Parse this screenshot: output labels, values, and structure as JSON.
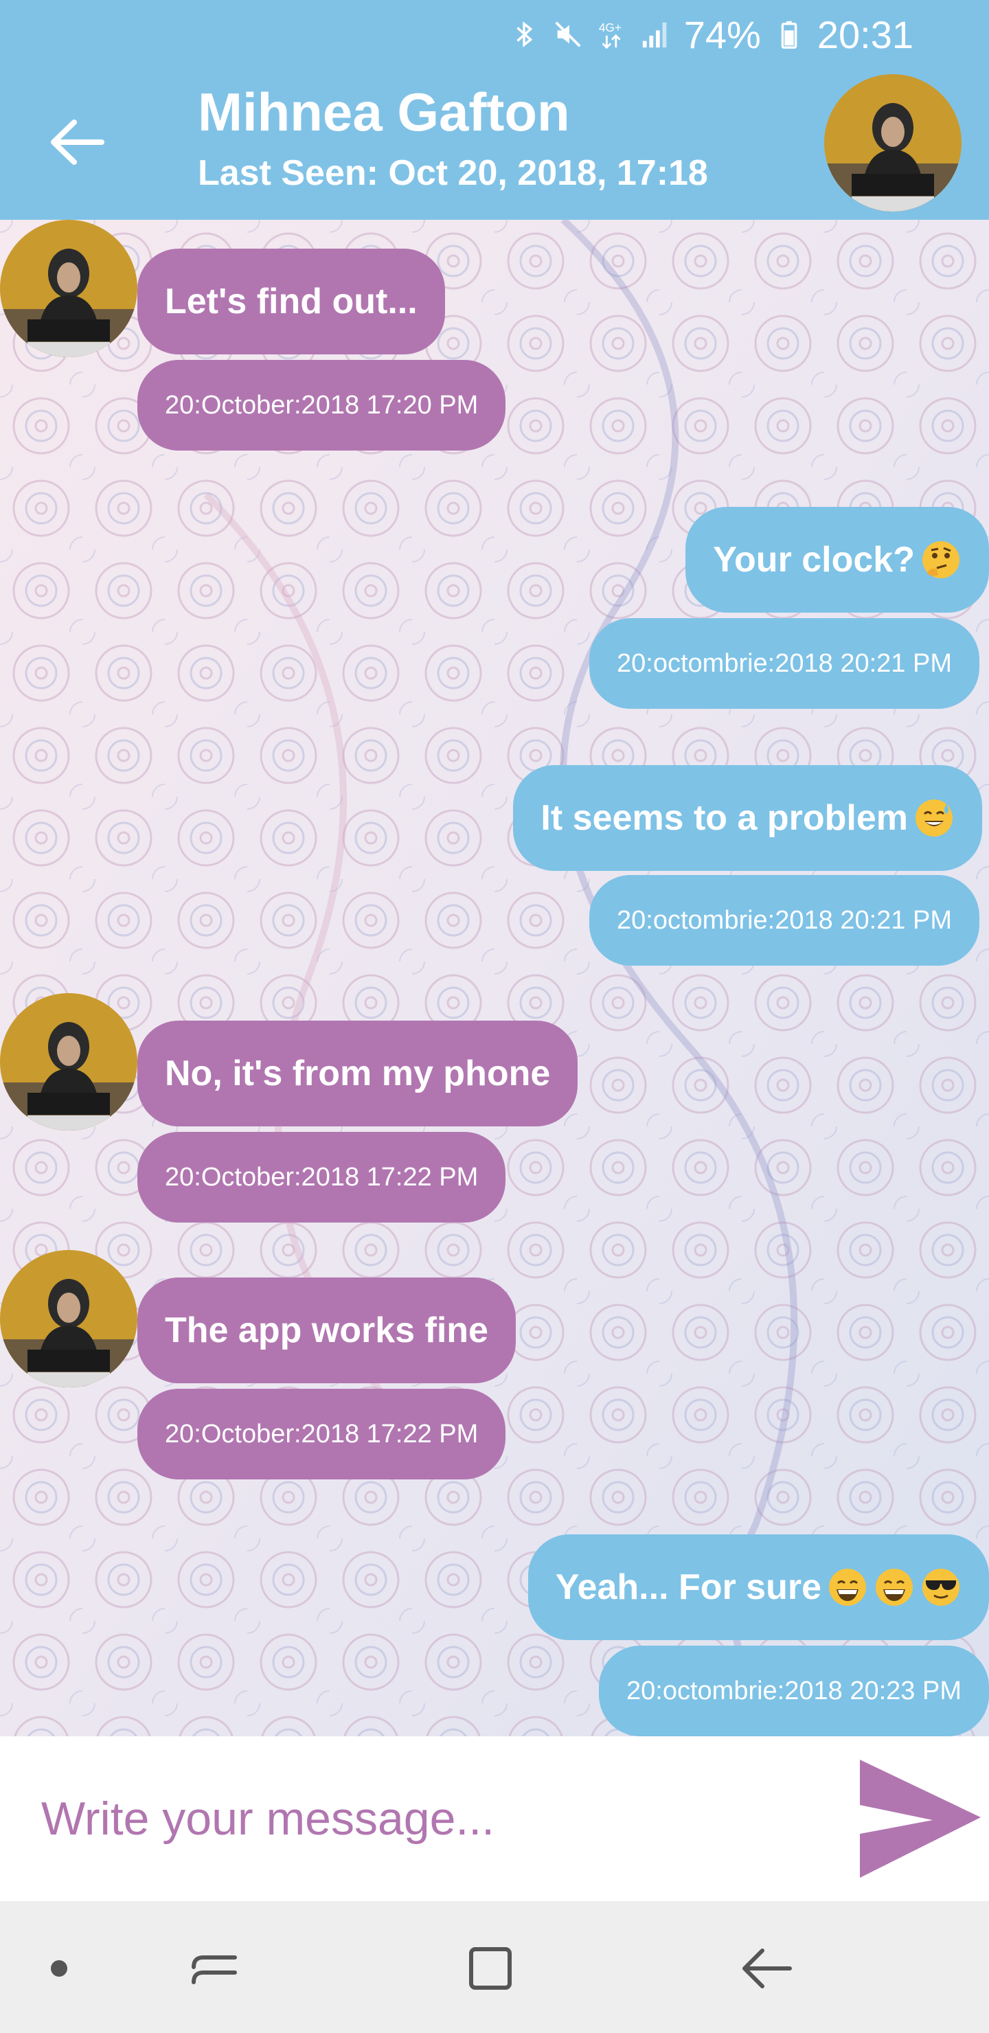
{
  "status_bar": {
    "battery": "74%",
    "time": "20:31",
    "icons": [
      "bluetooth-icon",
      "mute-icon",
      "network-4g-icon",
      "signal-icon",
      "battery-icon"
    ]
  },
  "header": {
    "name": "Mihnea Gafton",
    "last_seen": "Last Seen: Oct 20, 2018, 17:18",
    "color": "#80c2e6"
  },
  "messages": [
    {
      "side": "in",
      "text": "Let's find out...",
      "timestamp": "20:October:2018 17:20 PM",
      "emoji": []
    },
    {
      "side": "out",
      "text": "Your clock?",
      "timestamp": "20:octombrie:2018 20:21 PM",
      "emoji": [
        "thinking-emoji"
      ]
    },
    {
      "side": "out",
      "text": "It seems to a problem",
      "timestamp": "20:octombrie:2018 20:21 PM",
      "emoji": [
        "sweat-smile-emoji"
      ]
    },
    {
      "side": "in",
      "text": "No, it's from my phone",
      "timestamp": "20:October:2018 17:22 PM",
      "emoji": []
    },
    {
      "side": "in",
      "text": "The app works fine",
      "timestamp": "20:October:2018 17:22 PM",
      "emoji": []
    },
    {
      "side": "out",
      "text": "Yeah... For sure",
      "timestamp": "20:octombrie:2018 20:23 PM",
      "emoji": [
        "grin-emoji",
        "grin-emoji",
        "sunglasses-emoji"
      ]
    }
  ],
  "composer": {
    "placeholder": "Write your message...",
    "value": ""
  },
  "colors": {
    "incoming": "#b176b0",
    "outgoing": "#7ec2e6",
    "send": "#b176b0"
  },
  "navbar": {
    "items": [
      "dot-icon",
      "recents-icon",
      "home-icon",
      "back-icon"
    ]
  }
}
